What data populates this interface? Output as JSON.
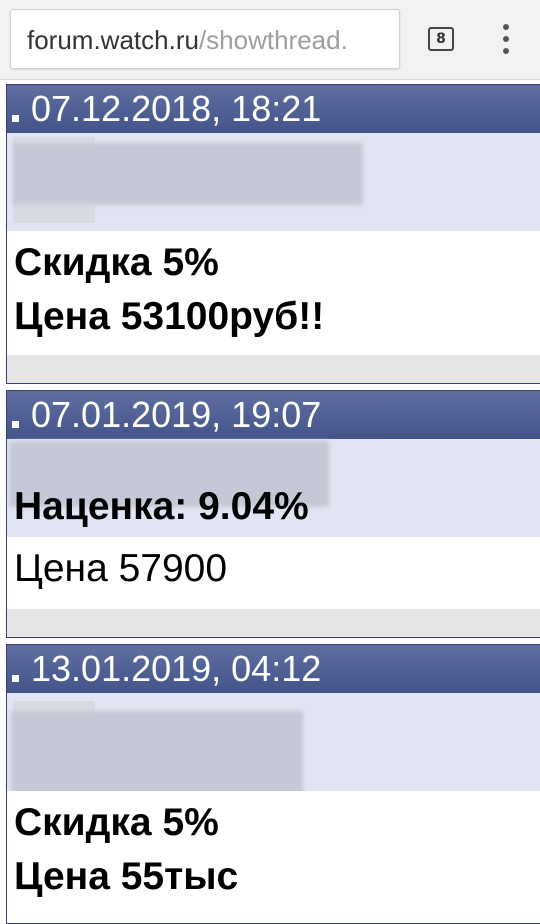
{
  "browser": {
    "url_host": "forum.watch.ru",
    "url_path": "/showthread.",
    "tab_count": "8",
    "menu_icon": "overflow-menu-icon"
  },
  "posts": [
    {
      "date": "07.12.2018, 18:21",
      "lines": [
        "Скидка 5%",
        "Цена 53100руб!!"
      ]
    },
    {
      "date": "07.01.2019, 19:07",
      "lines": [
        "Наценка: 9.04%",
        "Цена 57900"
      ]
    },
    {
      "date": "13.01.2019, 04:12",
      "lines": [
        "Скидка 5%",
        "Цена 55тыс"
      ]
    }
  ],
  "colors": {
    "header_bg": "#4b5a91",
    "userinfo_bg": "#e1e4f2",
    "footer_bg": "#e6e6e6"
  }
}
